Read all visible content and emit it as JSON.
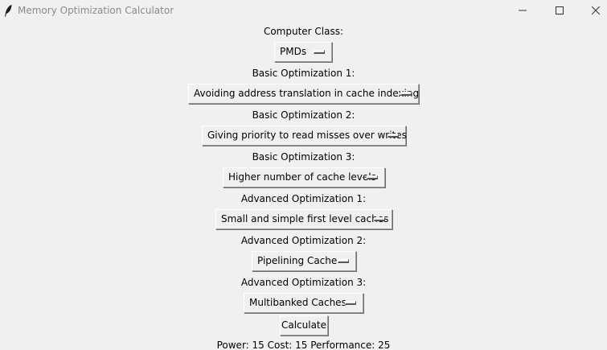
{
  "window": {
    "title": "Memory Optimization Calculator",
    "icon": "feather-icon"
  },
  "form": {
    "computer_class": {
      "label": "Computer Class:",
      "value": "PMDs"
    },
    "basic_1": {
      "label": "Basic Optimization 1:",
      "value": "Avoiding address translation in cache indexing"
    },
    "basic_2": {
      "label": "Basic Optimization 2:",
      "value": "Giving priority to read misses over writes"
    },
    "basic_3": {
      "label": "Basic Optimization 3:",
      "value": "Higher number of cache levels"
    },
    "advanced_1": {
      "label": "Advanced Optimization 1:",
      "value": "Small and simple first level caches"
    },
    "advanced_2": {
      "label": "Advanced Optimization 2:",
      "value": "Pipelining Cache"
    },
    "advanced_3": {
      "label": "Advanced Optimization 3:",
      "value": "Multibanked Caches"
    }
  },
  "actions": {
    "calculate_label": "Calculate"
  },
  "result": {
    "text": "Power: 15 Cost: 15 Performance: 25"
  }
}
